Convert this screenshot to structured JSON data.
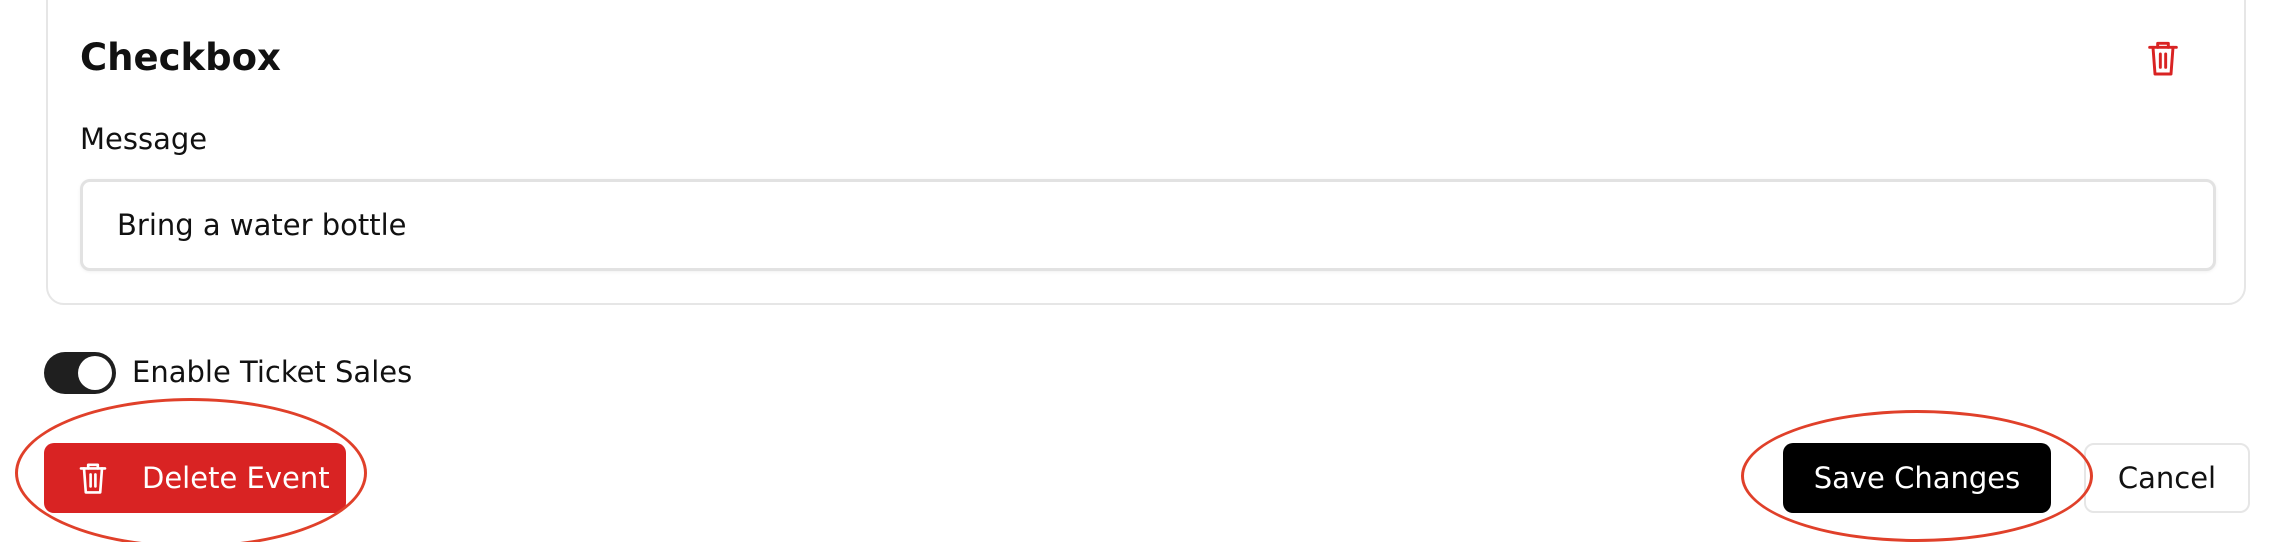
{
  "card": {
    "title": "Checkbox",
    "trash_icon": "trash-icon",
    "message_label": "Message",
    "message_value": "Bring a water bottle"
  },
  "toggle": {
    "label": "Enable Ticket Sales",
    "state": "on"
  },
  "actions": {
    "delete_label": "Delete Event",
    "delete_icon": "trash-icon",
    "save_label": "Save Changes",
    "cancel_label": "Cancel"
  },
  "colors": {
    "danger": "#d92323",
    "primary": "#000000",
    "annotation": "#e0402a"
  }
}
